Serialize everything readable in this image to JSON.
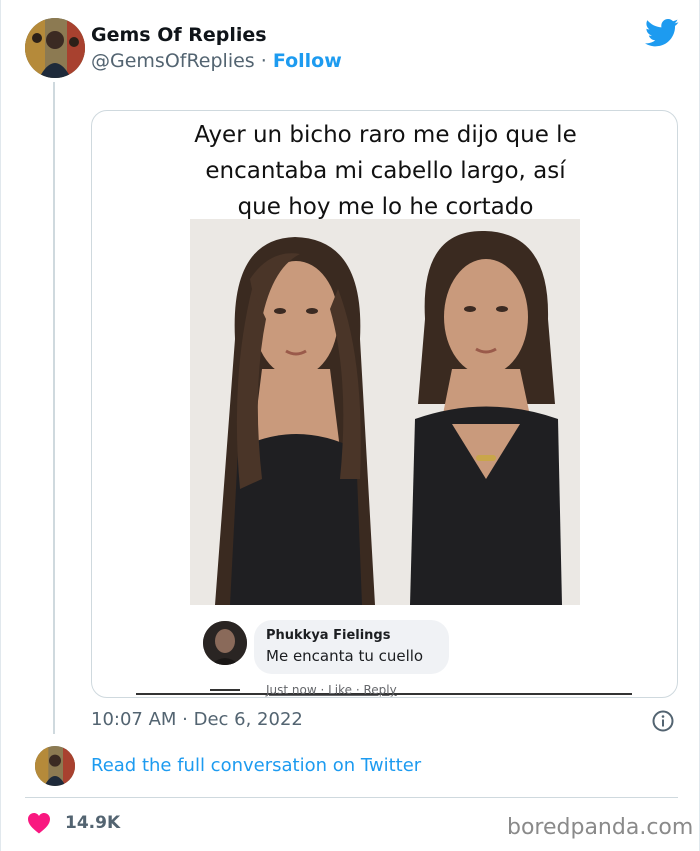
{
  "tweet": {
    "author_name": "Gems Of Replies",
    "author_handle": "@GemsOfReplies",
    "separator": "·",
    "follow_label": "Follow",
    "timestamp": "10:07 AM · Dec 6, 2022",
    "read_link": "Read the full conversation on Twitter",
    "like_count": "14.9K"
  },
  "media": {
    "caption": "Ayer un bicho raro me dijo que le\nencantaba mi cabello largo, así\nque hoy me lo he cortado",
    "comment": {
      "name": "Phukkya Fielings",
      "text": "Me encanta tu cuello",
      "actions": "Just now · Like · Reply"
    }
  },
  "footer": {
    "watermark": "boredpanda.com"
  },
  "colors": {
    "twitter_blue": "#1d9bf0",
    "like_pink": "#f91880",
    "muted_text": "#536471"
  },
  "icons": {
    "logo": "twitter-bird-icon",
    "info": "info-icon",
    "like": "heart-icon"
  }
}
